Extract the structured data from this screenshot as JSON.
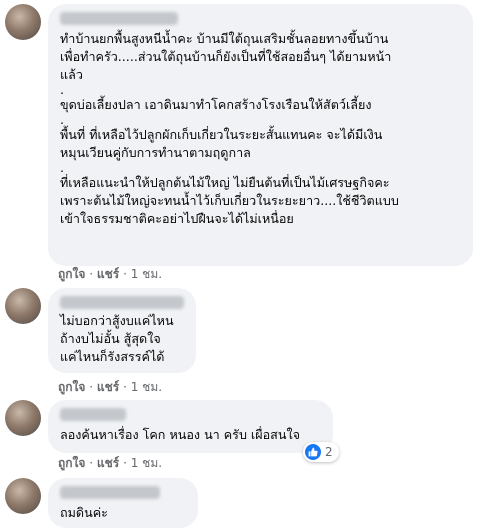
{
  "comments": [
    {
      "lines": [
        "ทำบ้านยกพื้นสูงหนีน้ำคะ บ้านมีใต้ถุนเสริมชั้นลอยทางขึ้นบ้าน",
        "เพื่อทำครัว.....ส่วนใต้ถุนบ้านก็ยังเป็นที่ใช้สอยอื่นๆ ได้ยามหน้า",
        "แล้ว",
        ".",
        "ขุดบ่อเลี้ยงปลา เอาดินมาทำโคกสร้างโรงเรือนให้สัตว์เลี้ยง",
        ".",
        "พื้นที่ ที่เหลือไว้ปลูกผักเก็บเกี่ยวในระยะสั้นแทนคะ จะได้มีเงิน",
        "หมุนเวียนคู่กับการทำนาตามฤดูกาล",
        ".",
        "ที่เหลือแนะนำให้ปลูกต้นไม้ใหญ่ ไม่ยืนต้นที่เป็นไม้เศรษฐกิจคะ",
        "เพราะต้นไม้ใหญ่จะทนน้ำไว้เก็บเกี่ยวในระยะยาว....ใช้ชีวิตแบบ",
        "เข้าใจธรรมชาติคะอย่าไปฝืนจะได้ไม่เหนื่อย"
      ],
      "like": "ถูกใจ",
      "reply": "แชร์",
      "time": "1 ชม."
    },
    {
      "lines": [
        "ไม่บอกว่าสู้งบแค่ไหน",
        "ถ้างบไม่อั้น สู้สุดใจ",
        "แค่ไหนก็รังสรรค์ได้"
      ],
      "like": "ถูกใจ",
      "reply": "แชร์",
      "time": "1 ชม."
    },
    {
      "lines": [
        "ลองค้นหาเรื่อง โคก หนอง นา ครับ เผื่อสนใจ"
      ],
      "like": "ถูกใจ",
      "reply": "แชร์",
      "time": "1 ชม.",
      "reaction_count": "2",
      "reaction_icon": "like-icon"
    },
    {
      "lines": [
        "ถมดินค่ะ"
      ]
    }
  ],
  "colors": {
    "bubble": "#f0f2f5",
    "meta": "#65676b",
    "like": "#1877f2"
  }
}
